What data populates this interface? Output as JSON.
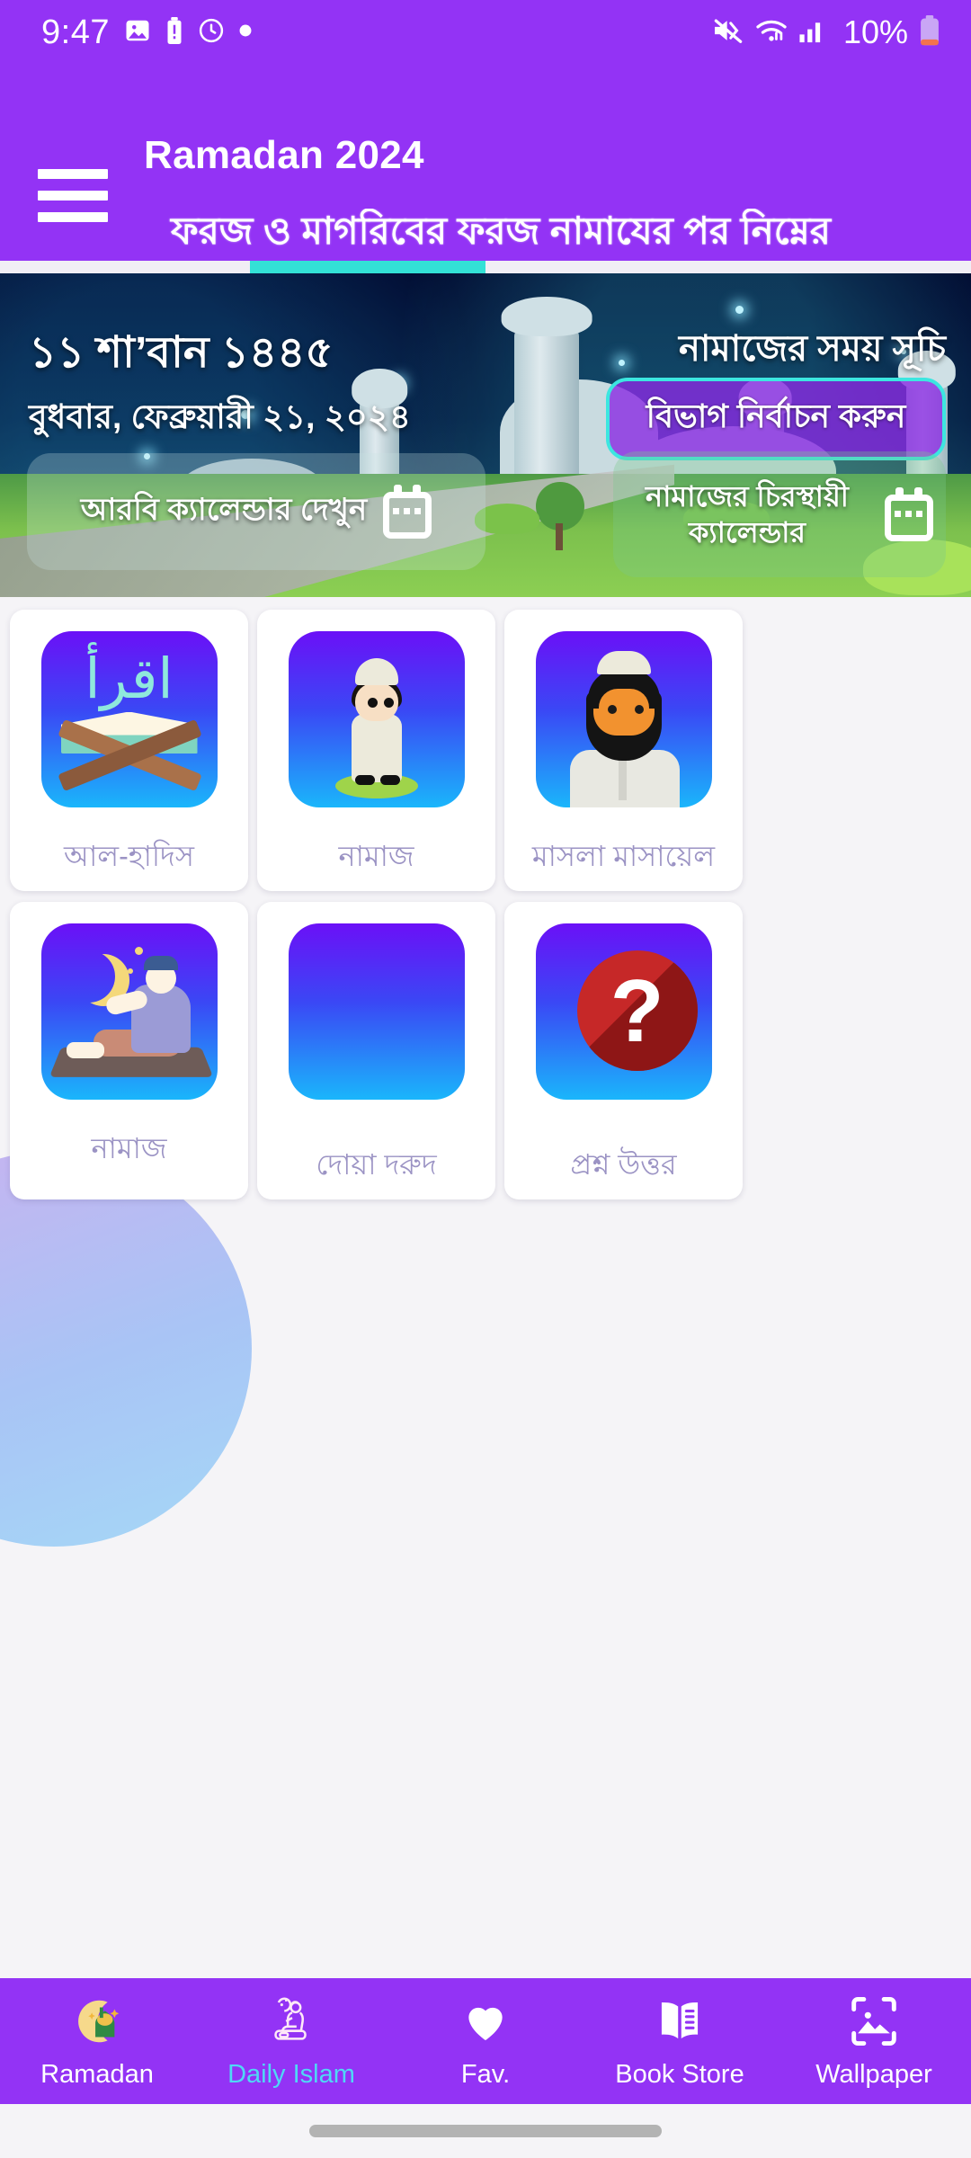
{
  "status_bar": {
    "time": "9:47",
    "battery_percent": "10%",
    "icons": [
      "image-icon",
      "battery-alert-icon",
      "alarm-icon",
      "dot-icon",
      "mute-icon",
      "wifi-icon",
      "signal-icon",
      "battery-icon"
    ]
  },
  "app_bar": {
    "title": "Ramadan 2024",
    "menu_icon": "hamburger-icon",
    "marquee_text": "ফরজ ও মাগরিবের ফরজ নামাযের পর নিম্নের"
  },
  "banner": {
    "hijri_date": "১১ শা’বান ১৪৪৫",
    "gregorian_date": "বুধবার, ফেব্রুয়ারী ২১, ২০২৪",
    "prayer_schedule_title": "নামাজের সময় সূচি",
    "select_division_button": "বিভাগ নির্বাচন করুন",
    "arabic_calendar_button": "আরবি ক্যালেন্ডার দেখুন",
    "permanent_calendar_button": "নামাজের চিরস্থায়ী ক্যালেন্ডার",
    "calendar_icon": "calendar-icon"
  },
  "grid": {
    "cards": [
      {
        "label": "আল-হাদিস",
        "icon": "quran-rehal-icon",
        "arabic": "اقرأ"
      },
      {
        "label": "নামাজ",
        "icon": "boy-praying-icon"
      },
      {
        "label": "মাসলা মাসায়েল",
        "icon": "bearded-man-icon"
      },
      {
        "label": "নামাজ",
        "icon": "night-prayer-icon"
      },
      {
        "label": "দোয়া দরুদ",
        "icon": "blank-icon"
      },
      {
        "label": "প্রশ্ন উত্তর",
        "icon": "question-mark-icon",
        "glyph": "?"
      }
    ]
  },
  "bottom_nav": {
    "items": [
      {
        "label": "Ramadan",
        "icon": "moon-mosque-icon",
        "active": false
      },
      {
        "label": "Daily Islam",
        "icon": "praying-person-icon",
        "active": true
      },
      {
        "label": "Fav.",
        "icon": "heart-icon",
        "active": false
      },
      {
        "label": "Book Store",
        "icon": "open-book-icon",
        "active": false
      },
      {
        "label": "Wallpaper",
        "icon": "wallpaper-icon",
        "active": false
      }
    ]
  },
  "colors": {
    "brand_purple": "#9333f5",
    "accent_cyan": "#33e1d6",
    "active_nav": "#4fd8f5",
    "card_label": "#9b93c4",
    "page_bg": "#f5f4f7"
  }
}
